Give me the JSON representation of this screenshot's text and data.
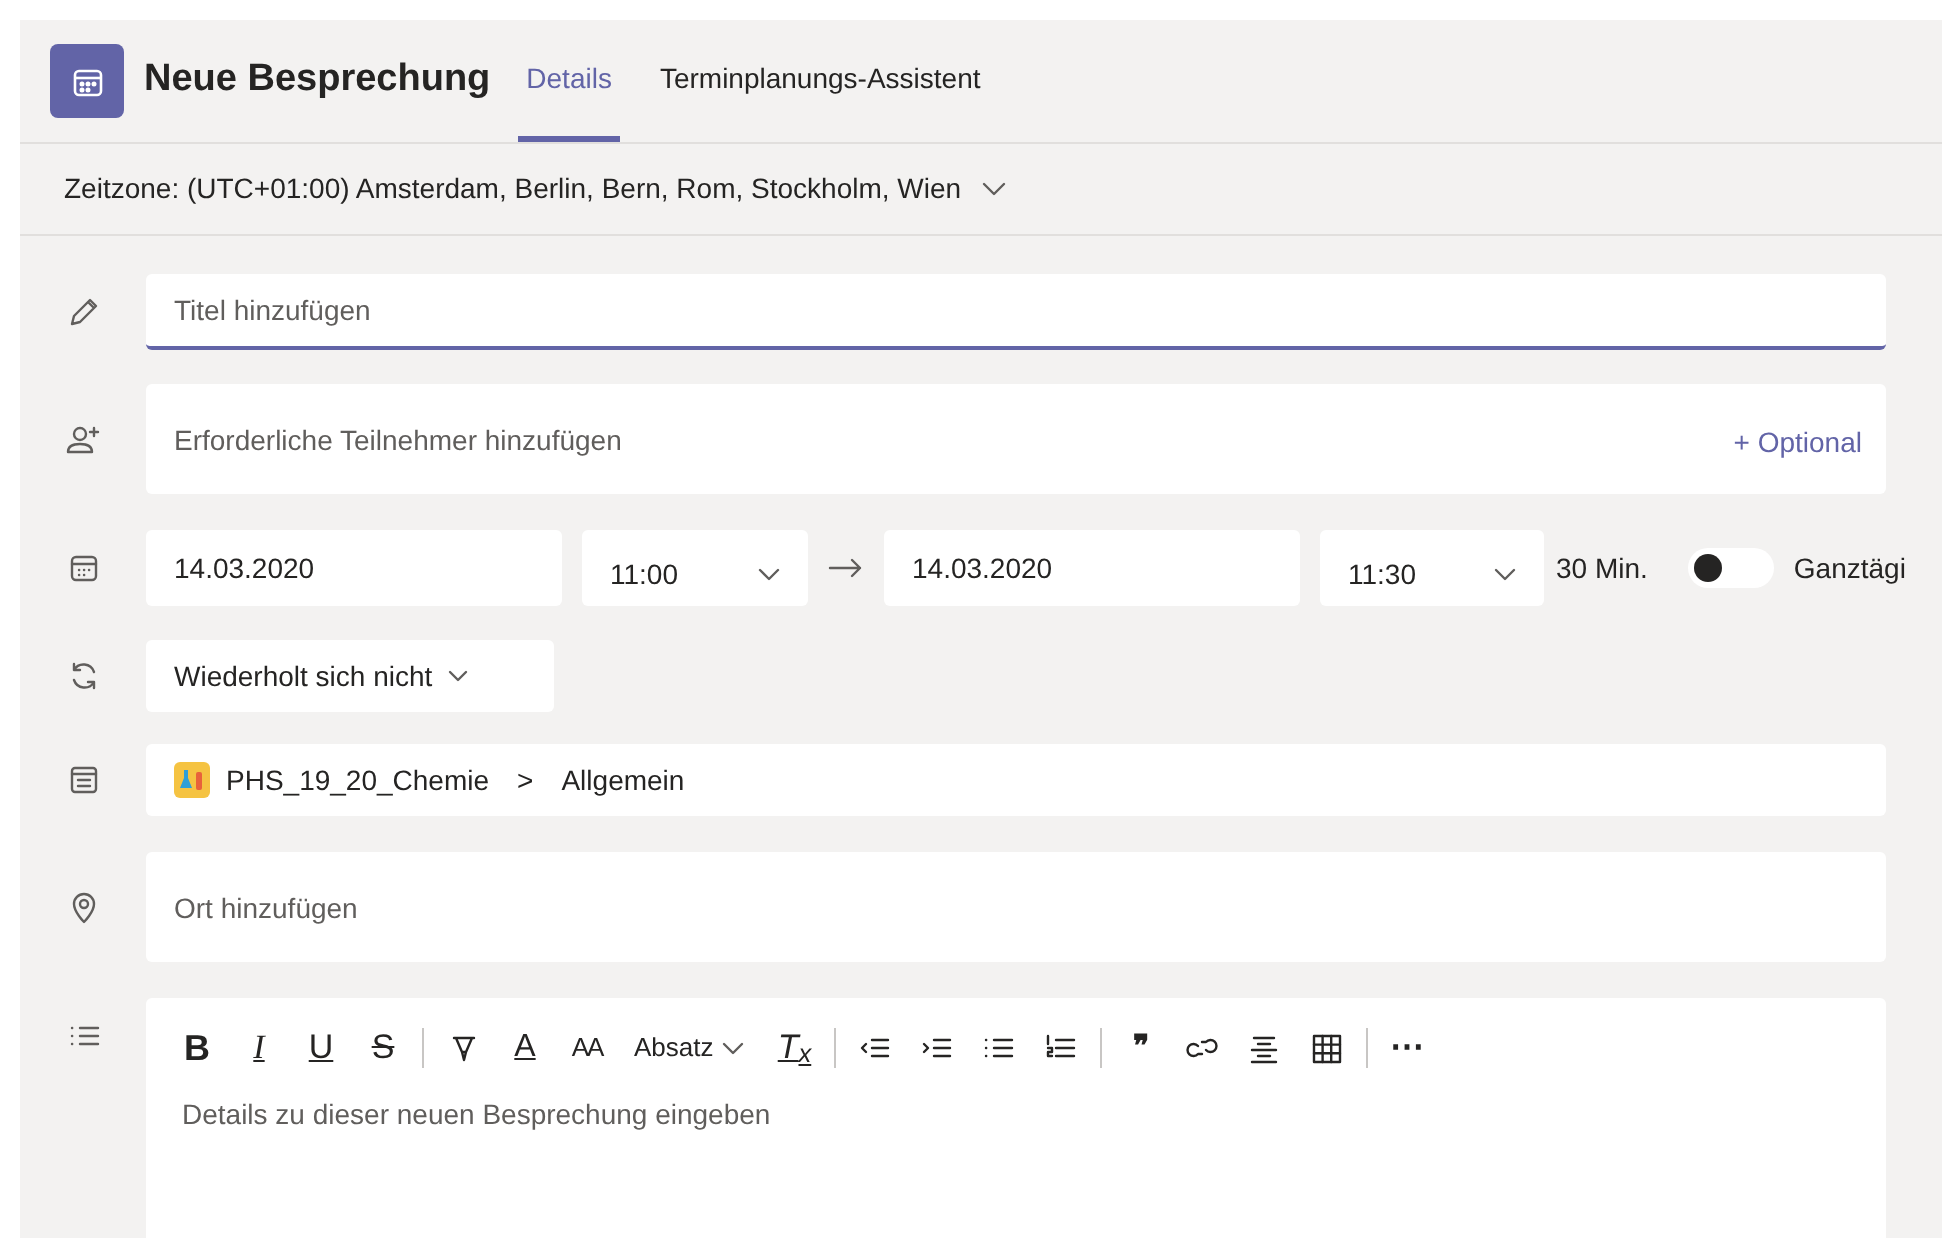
{
  "header": {
    "title": "Neue Besprechung",
    "tabs": [
      {
        "label": "Details",
        "selected": true
      },
      {
        "label": "Terminplanungs-Assistent",
        "selected": false
      }
    ]
  },
  "timezone": {
    "label": "Zeitzone: (UTC+01:00) Amsterdam, Berlin, Bern, Rom, Stockholm, Wien"
  },
  "title_field": {
    "placeholder": "Titel hinzufügen",
    "focused": true
  },
  "attendees": {
    "placeholder": "Erforderliche Teilnehmer hinzufügen",
    "optional_link": "+ Optional"
  },
  "schedule": {
    "start_date": "14.03.2020",
    "start_time": "11:00",
    "end_date": "14.03.2020",
    "end_time": "11:30",
    "duration": "30 Min.",
    "all_day": {
      "label": "Ganztägi",
      "on": false
    }
  },
  "recurrence": {
    "value": "Wiederholt sich nicht"
  },
  "channel": {
    "team": "PHS_19_20_Chemie",
    "separator": ">",
    "channel": "Allgemein"
  },
  "location": {
    "placeholder": "Ort hinzufügen"
  },
  "editor": {
    "toolbar": {
      "bold": "B",
      "italic": "I",
      "underline": "U",
      "strike": "S",
      "font_color": "A",
      "font_size": "AA",
      "paragraph": "Absatz",
      "clear": "T$_{x}$",
      "quote": "❞",
      "more": "⋯"
    },
    "placeholder": "Details zu dieser neuen Besprechung eingeben"
  }
}
